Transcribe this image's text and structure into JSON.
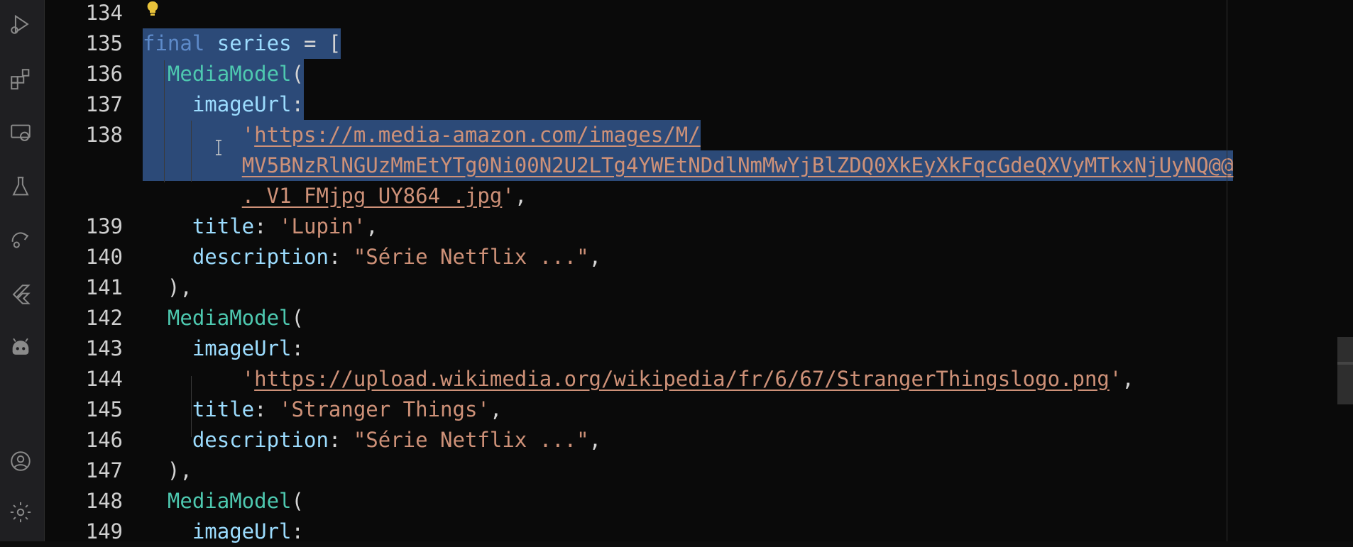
{
  "activity_bar": {
    "icons": [
      "run-debug-icon",
      "extensions-icon",
      "remote-explorer-icon",
      "testing-icon",
      "source-control-sync-icon",
      "flutter-icon",
      "android-icon",
      "account-icon",
      "settings-icon"
    ]
  },
  "editor": {
    "lines": [
      {
        "num": "134"
      },
      {
        "num": "135",
        "tokens": [
          {
            "t": "kw",
            "v": "final"
          },
          {
            "t": "punct",
            "v": " "
          },
          {
            "t": "prop",
            "v": "series"
          },
          {
            "t": "punct",
            "v": " = ["
          }
        ]
      },
      {
        "num": "136",
        "tokens": [
          {
            "t": "punct",
            "v": "  "
          },
          {
            "t": "cls",
            "v": "MediaModel"
          },
          {
            "t": "punct",
            "v": "("
          }
        ]
      },
      {
        "num": "137",
        "tokens": [
          {
            "t": "punct",
            "v": "    "
          },
          {
            "t": "prop",
            "v": "imageUrl"
          },
          {
            "t": "punct",
            "v": ":"
          }
        ]
      },
      {
        "num": "138",
        "tokens": [
          {
            "t": "punct",
            "v": "        "
          },
          {
            "t": "str",
            "v": "'"
          },
          {
            "t": "url",
            "v": "https://m.media-amazon.com/images/M/"
          }
        ]
      },
      {
        "num": "",
        "tokens": [
          {
            "t": "punct",
            "v": "        "
          },
          {
            "t": "url",
            "v": "MV5BNzRlNGUzMmEtYTg0Ni00N2U2LTg4YWEtNDdlNmMwYjBlZDQ0XkEyXkFqcGdeQXVyMTkxNjUyNQ@@"
          }
        ]
      },
      {
        "num": "",
        "tokens": [
          {
            "t": "punct",
            "v": "        "
          },
          {
            "t": "url",
            "v": "._V1_FMjpg_UY864_.jpg"
          },
          {
            "t": "str",
            "v": "'"
          },
          {
            "t": "punct",
            "v": ","
          }
        ]
      },
      {
        "num": "139",
        "tokens": [
          {
            "t": "punct",
            "v": "    "
          },
          {
            "t": "prop",
            "v": "title"
          },
          {
            "t": "punct",
            "v": ": "
          },
          {
            "t": "str",
            "v": "'Lupin'"
          },
          {
            "t": "punct",
            "v": ","
          }
        ]
      },
      {
        "num": "140",
        "tokens": [
          {
            "t": "punct",
            "v": "    "
          },
          {
            "t": "prop",
            "v": "description"
          },
          {
            "t": "punct",
            "v": ": "
          },
          {
            "t": "str",
            "v": "\"Série Netflix ...\""
          },
          {
            "t": "punct",
            "v": ","
          }
        ]
      },
      {
        "num": "141",
        "tokens": [
          {
            "t": "punct",
            "v": "  ),"
          }
        ]
      },
      {
        "num": "142",
        "tokens": [
          {
            "t": "punct",
            "v": "  "
          },
          {
            "t": "cls",
            "v": "MediaModel"
          },
          {
            "t": "punct",
            "v": "("
          }
        ]
      },
      {
        "num": "143",
        "tokens": [
          {
            "t": "punct",
            "v": "    "
          },
          {
            "t": "prop",
            "v": "imageUrl"
          },
          {
            "t": "punct",
            "v": ":"
          }
        ]
      },
      {
        "num": "144",
        "tokens": [
          {
            "t": "punct",
            "v": "        "
          },
          {
            "t": "str",
            "v": "'"
          },
          {
            "t": "url",
            "v": "https://upload.wikimedia.org/wikipedia/fr/6/67/StrangerThingslogo.png"
          },
          {
            "t": "str",
            "v": "'"
          },
          {
            "t": "punct",
            "v": ","
          }
        ]
      },
      {
        "num": "145",
        "tokens": [
          {
            "t": "punct",
            "v": "    "
          },
          {
            "t": "prop",
            "v": "title"
          },
          {
            "t": "punct",
            "v": ": "
          },
          {
            "t": "str",
            "v": "'Stranger Things'"
          },
          {
            "t": "punct",
            "v": ","
          }
        ]
      },
      {
        "num": "146",
        "tokens": [
          {
            "t": "punct",
            "v": "    "
          },
          {
            "t": "prop",
            "v": "description"
          },
          {
            "t": "punct",
            "v": ": "
          },
          {
            "t": "str",
            "v": "\"Série Netflix ...\""
          },
          {
            "t": "punct",
            "v": ","
          }
        ]
      },
      {
        "num": "147",
        "tokens": [
          {
            "t": "punct",
            "v": "  ),"
          }
        ]
      },
      {
        "num": "148",
        "tokens": [
          {
            "t": "punct",
            "v": "  "
          },
          {
            "t": "cls",
            "v": "MediaModel"
          },
          {
            "t": "punct",
            "v": "("
          }
        ]
      },
      {
        "num": "149",
        "tokens": [
          {
            "t": "punct",
            "v": "    "
          },
          {
            "t": "prop",
            "v": "imageUrl"
          },
          {
            "t": "punct",
            "v": ":"
          }
        ]
      }
    ]
  },
  "colors": {
    "background": "#0a0a0a",
    "selection": "#2c4a78",
    "keyword": "#5d8ac9",
    "class": "#4ec9b0",
    "property": "#9cdcfe",
    "string": "#ce9178"
  }
}
